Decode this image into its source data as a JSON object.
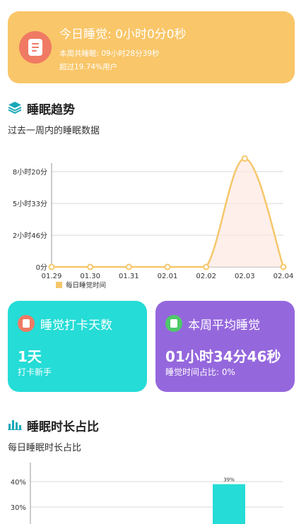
{
  "header_card": {
    "title": "今日睡觉: 0小时0分0秒",
    "week_total": "本周共睡眠: 09小时28分39秒",
    "exceed": "超过19.74%用户",
    "bg_color": "#f9c669",
    "icon": "document-icon"
  },
  "trend_section": {
    "title": "睡眠趋势",
    "icon": "layers-icon",
    "description": "过去一周内的睡眠数据"
  },
  "chart_data": [
    {
      "type": "line",
      "x": [
        "01.29",
        "01.30",
        "01.31",
        "02.01",
        "02.02",
        "02.03",
        "02.04"
      ],
      "y_ticks": [
        "0分",
        "2小时46分",
        "5小时33分",
        "8小时20分"
      ],
      "y_tick_values": [
        0,
        166,
        333,
        500
      ],
      "ylim": [
        0,
        500
      ],
      "series": [
        {
          "name": "每日睡觉时间",
          "values": [
            0,
            0,
            0,
            0,
            0,
            568.65,
            0
          ],
          "color": "#f5c76a"
        }
      ],
      "legend_position": "bottom"
    },
    {
      "type": "bar",
      "y_ticks": [
        "30%",
        "40%"
      ],
      "y_tick_values": [
        30,
        40
      ],
      "series": [
        {
          "values": [
            39
          ],
          "labels": [
            "39%"
          ],
          "color": "#25dcd6"
        }
      ]
    }
  ],
  "stats": {
    "checkin": {
      "label": "睡觉打卡天数",
      "value": "1天",
      "sub": "打卡新手",
      "icon": "calendar-icon",
      "color": "#25dcd6"
    },
    "average": {
      "label": "本周平均睡觉",
      "value": "01小时34分46秒",
      "sub": "睡觉时间占比: 0%",
      "icon": "clock-icon",
      "color": "#9567dd"
    }
  },
  "ratio_section": {
    "title": "睡眠时长占比",
    "icon": "bar-chart-icon",
    "description": "每日睡眠时长占比"
  }
}
